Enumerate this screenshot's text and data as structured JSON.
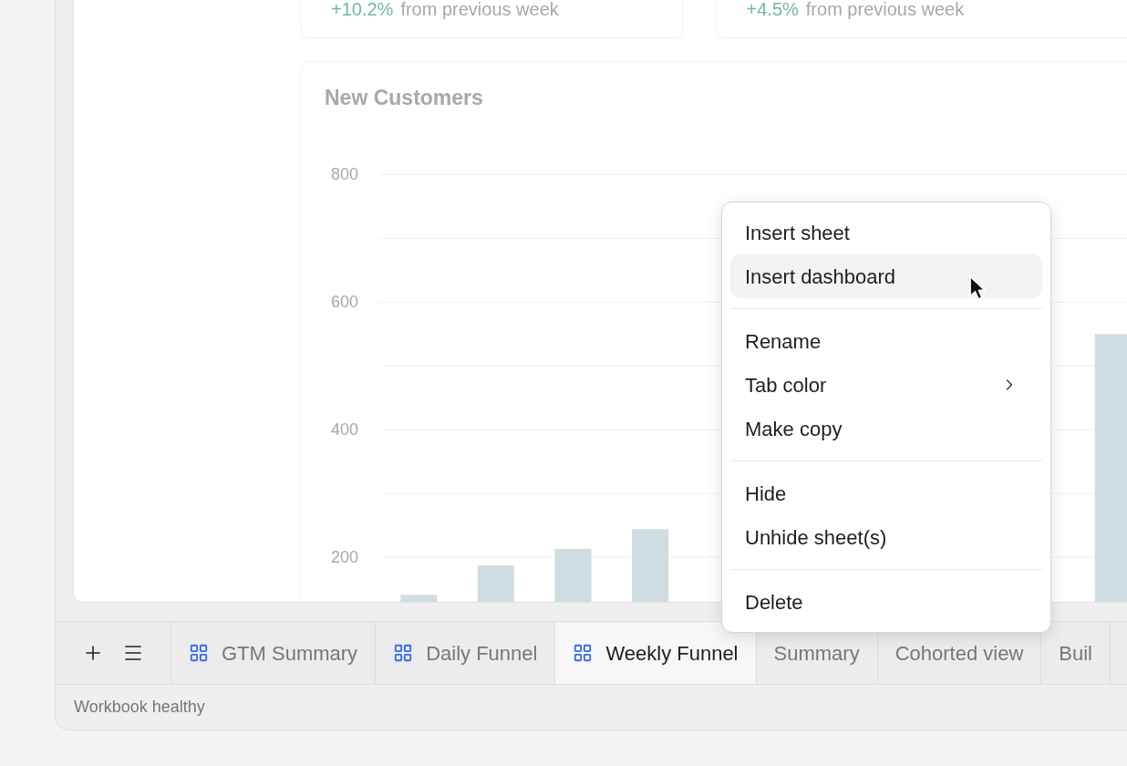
{
  "stat_cards": [
    {
      "change": "+10.2%",
      "caption": "from previous week"
    },
    {
      "change": "+4.5%",
      "caption": "from previous week"
    }
  ],
  "chart_card": {
    "chart_data": {
      "type": "bar",
      "title": "New Customers",
      "grid": true,
      "ylim": [
        130,
        800
      ],
      "yticks": [
        200,
        400,
        600,
        800
      ],
      "series": [
        {
          "color": "#cddde1",
          "values": [
            141,
            187,
            213,
            244,
            null,
            null,
            null,
            null,
            null,
            550
          ]
        }
      ]
    }
  },
  "sheet_tabs": {
    "controls": [
      {
        "kind": "add"
      },
      {
        "kind": "menu"
      }
    ],
    "tabs": [
      {
        "label": "GTM Summary",
        "kind": "dashboard",
        "selected": false
      },
      {
        "label": "Daily Funnel",
        "kind": "dashboard",
        "selected": false
      },
      {
        "label": "Weekly Funnel",
        "kind": "dashboard",
        "selected": true
      },
      {
        "label": "Summary",
        "kind": "sheet",
        "selected": false
      },
      {
        "label": "Cohorted view",
        "kind": "sheet",
        "selected": false
      },
      {
        "label": "Buil",
        "kind": "sheet",
        "selected": false
      }
    ]
  },
  "status_bar": {
    "text": "Workbook healthy"
  },
  "context_menu": {
    "sections": [
      [
        {
          "label": "Insert sheet",
          "highlighted": false,
          "has_submenu": false
        },
        {
          "label": "Insert dashboard",
          "highlighted": true,
          "has_submenu": false
        }
      ],
      [
        {
          "label": "Rename",
          "highlighted": false,
          "has_submenu": false
        },
        {
          "label": "Tab color",
          "highlighted": false,
          "has_submenu": true
        },
        {
          "label": "Make copy",
          "highlighted": false,
          "has_submenu": false
        }
      ],
      [
        {
          "label": "Hide",
          "highlighted": false,
          "has_submenu": false
        },
        {
          "label": "Unhide sheet(s)",
          "highlighted": false,
          "has_submenu": false
        }
      ],
      [
        {
          "label": "Delete",
          "highlighted": false,
          "has_submenu": false
        }
      ]
    ]
  }
}
